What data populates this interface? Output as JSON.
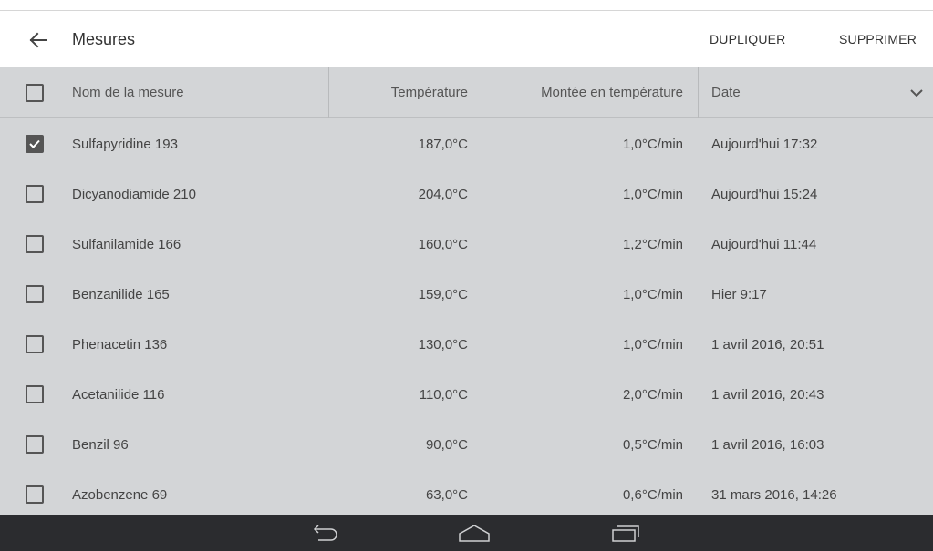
{
  "appbar": {
    "title": "Mesures",
    "back_icon": "arrow-left-icon",
    "actions": {
      "duplicate": "DUPLIQUER",
      "delete": "SUPPRIMER"
    }
  },
  "table": {
    "headers": {
      "name": "Nom de la mesure",
      "temperature": "Température",
      "ramp": "Montée en température",
      "date": "Date"
    },
    "sort_icon": "chevron-down-icon",
    "rows": [
      {
        "checked": true,
        "name": "Sulfapyridine 193",
        "temperature": "187,0°C",
        "ramp": "1,0°C/min",
        "date": "Aujourd'hui 17:32"
      },
      {
        "checked": false,
        "name": "Dicyanodiamide 210",
        "temperature": "204,0°C",
        "ramp": "1,0°C/min",
        "date": "Aujourd'hui 15:24"
      },
      {
        "checked": false,
        "name": "Sulfanilamide 166",
        "temperature": "160,0°C",
        "ramp": "1,2°C/min",
        "date": "Aujourd'hui 11:44"
      },
      {
        "checked": false,
        "name": "Benzanilide 165",
        "temperature": "159,0°C",
        "ramp": "1,0°C/min",
        "date": "Hier 9:17"
      },
      {
        "checked": false,
        "name": "Phenacetin 136",
        "temperature": "130,0°C",
        "ramp": "1,0°C/min",
        "date": "1 avril 2016, 20:51"
      },
      {
        "checked": false,
        "name": "Acetanilide 116",
        "temperature": "110,0°C",
        "ramp": "2,0°C/min",
        "date": "1 avril 2016, 20:43"
      },
      {
        "checked": false,
        "name": "Benzil 96",
        "temperature": "90,0°C",
        "ramp": "0,5°C/min",
        "date": "1 avril 2016, 16:03"
      },
      {
        "checked": false,
        "name": "Azobenzene 69",
        "temperature": "63,0°C",
        "ramp": "0,6°C/min",
        "date": "31 mars 2016, 14:26"
      }
    ]
  },
  "navbar": {
    "buttons": [
      "back-nav-icon",
      "home-nav-icon",
      "recent-apps-icon"
    ]
  },
  "colors": {
    "table_bg": "#d3d5d7",
    "navbar_bg": "#2b2c2f",
    "text": "#333333"
  }
}
